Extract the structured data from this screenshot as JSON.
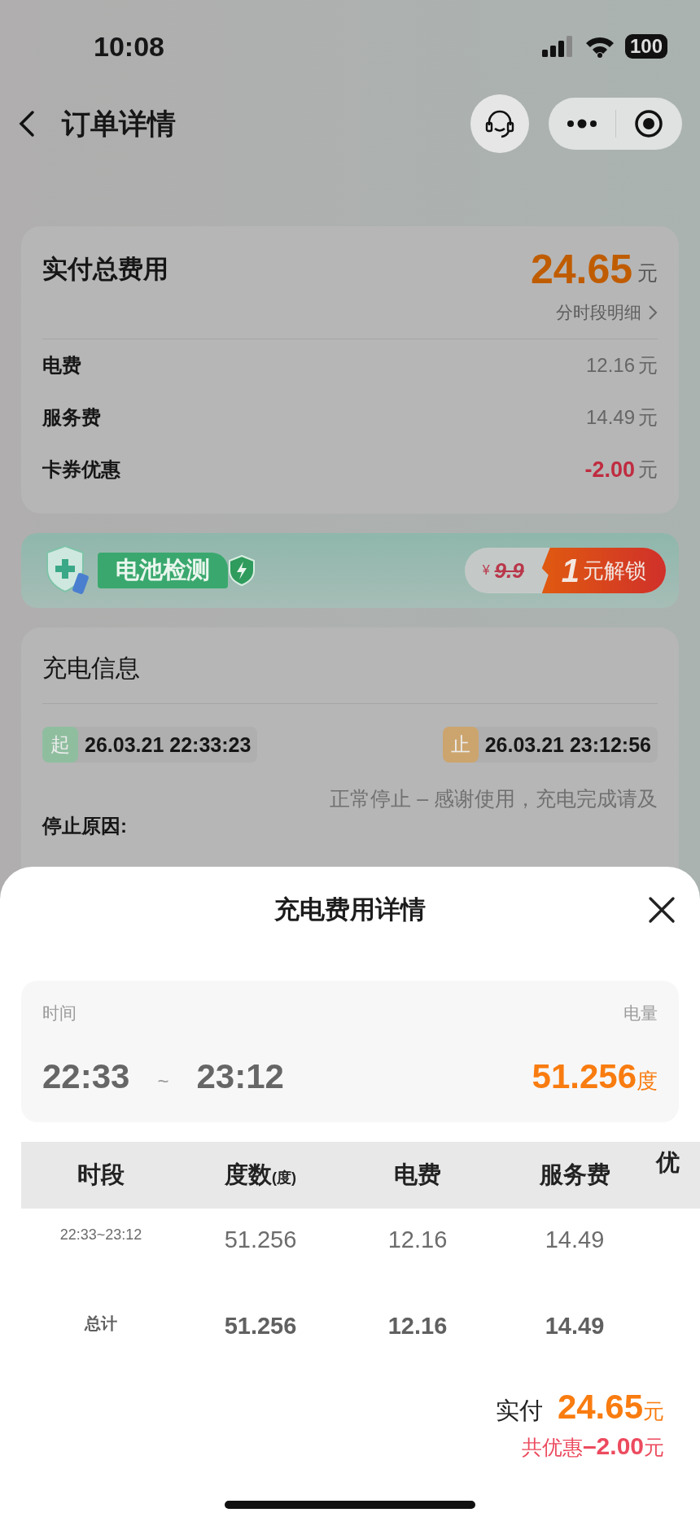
{
  "status_bar": {
    "time": "10:08",
    "battery": "100"
  },
  "nav": {
    "title": "订单详情"
  },
  "fee_card": {
    "title": "实付总费用",
    "amount": "24.65",
    "unit": "元",
    "detail_link": "分时段明细",
    "items": [
      {
        "label": "电费",
        "value": "12.16",
        "unit": "元",
        "kind": "normal"
      },
      {
        "label": "服务费",
        "value": "14.49",
        "unit": "元",
        "kind": "normal"
      },
      {
        "label": "卡券优惠",
        "value": "-2.00",
        "unit": "元",
        "kind": "discount"
      }
    ]
  },
  "banner": {
    "title": "电池检测",
    "currency": "¥",
    "original_price": "9.9",
    "offer_number": "1",
    "offer_text": "元解锁"
  },
  "charging_info": {
    "title": "充电信息",
    "times": [
      {
        "tag": "起",
        "time": "26.03.21 22:33:23",
        "kind": "start"
      },
      {
        "tag": "止",
        "time": "26.03.21 23:12:56",
        "kind": "stop"
      }
    ],
    "stop_reason_label": "停止原因:",
    "stop_reason": "正常停止 – 感谢使用，充电完成请及"
  },
  "sheet": {
    "title": "充电费用详情",
    "time_label": "时间",
    "energy_label": "电量",
    "start_time": "22:33",
    "separator": "~",
    "end_time": "23:12",
    "energy": "51.256",
    "energy_unit": "度",
    "table": {
      "columns": [
        {
          "label": "时段"
        },
        {
          "label": "度数",
          "unit": "(度)"
        },
        {
          "label": "电费"
        },
        {
          "label": "服务费"
        },
        {
          "label": "优"
        }
      ],
      "rows": [
        {
          "kind": "period",
          "cells": [
            "22:33~23:12",
            "51.256",
            "12.16",
            "14.49"
          ]
        },
        {
          "kind": "total",
          "cells": [
            "总计",
            "51.256",
            "12.16",
            "14.49"
          ]
        }
      ]
    },
    "paid_label": "实付",
    "paid_amount": "24.65",
    "paid_unit": "元",
    "discount_total": "共优惠**–2.00**元"
  }
}
